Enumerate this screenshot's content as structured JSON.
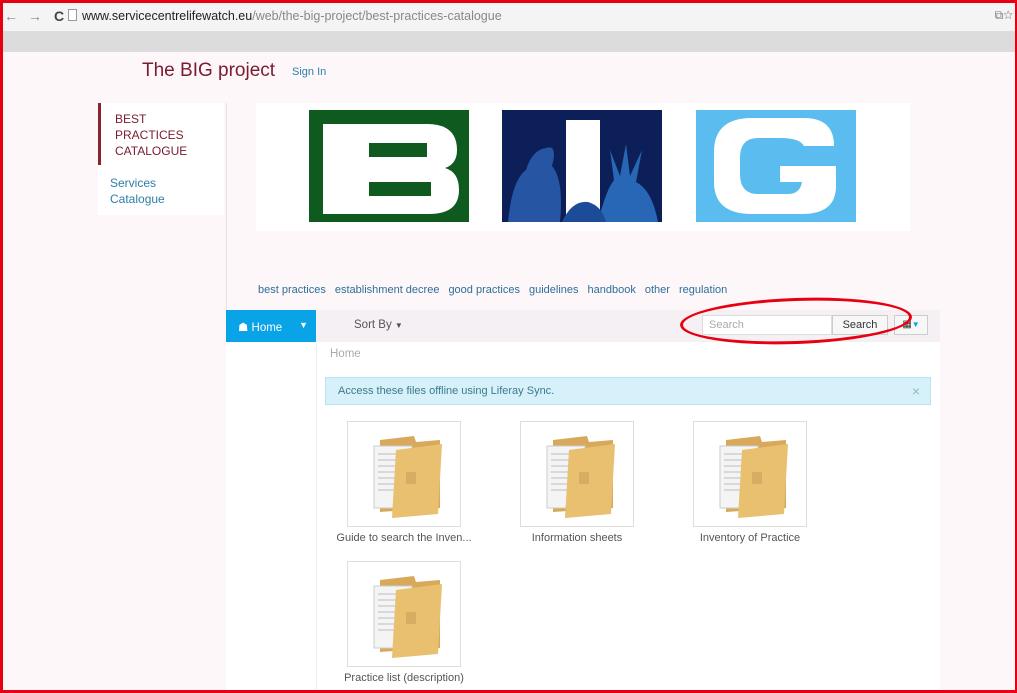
{
  "browser": {
    "back": "←",
    "forward": "→",
    "reload": "C",
    "url_domain": "www.servicecentrelifewatch.eu",
    "url_path": "/web/the-big-project/best-practices-catalogue"
  },
  "header": {
    "site_title": "The BIG project",
    "sign_in": "Sign In"
  },
  "sidebar": {
    "items": [
      {
        "label": "BEST PRACTICES CATALOGUE",
        "active": true
      },
      {
        "label": "Services Catalogue",
        "active": false
      }
    ]
  },
  "banner": {
    "letters": [
      "B",
      "I",
      "G"
    ],
    "colors": [
      "#0e5a1f",
      "#0d1f58",
      "#5bbcf0"
    ]
  },
  "tags": [
    "best practices",
    "establishment decree",
    "good practices",
    "guidelines",
    "handbook",
    "other",
    "regulation"
  ],
  "toolbar": {
    "home_label": "Home",
    "sort_label": "Sort By",
    "search_placeholder": "Search",
    "search_button": "Search"
  },
  "breadcrumb": "Home",
  "alert": {
    "text": "Access these files offline using Liferay Sync.",
    "close": "×"
  },
  "folders": [
    {
      "label": "Guide to search the Inven..."
    },
    {
      "label": "Information sheets"
    },
    {
      "label": "Inventory of Practice"
    },
    {
      "label": "Practice list (description)"
    }
  ],
  "colors": {
    "accent": "#09a3e8",
    "brand": "#7a1b2e",
    "annotation": "#e60012"
  }
}
